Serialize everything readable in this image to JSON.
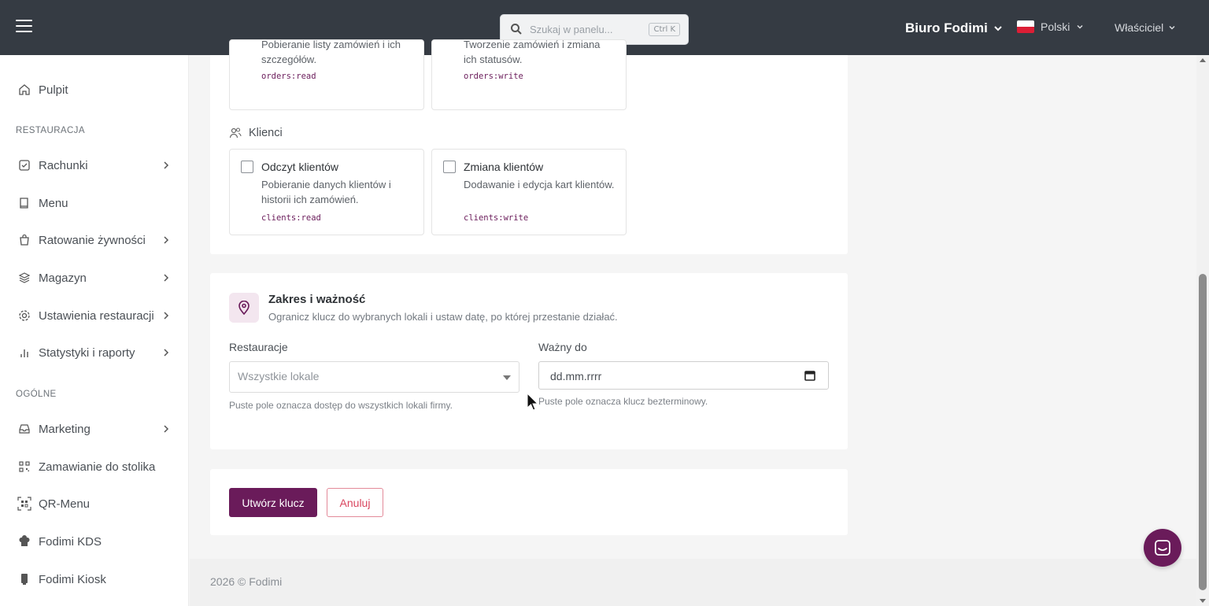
{
  "topbar": {
    "search_placeholder": "Szukaj w panelu...",
    "search_shortcut": "Ctrl K",
    "company": "Biuro Fodimi",
    "language": "Polski",
    "role": "Właściciel"
  },
  "sidebar": {
    "dashboard": "Pulpit",
    "section_restaurant": "RESTAURACJA",
    "restaurant_items": [
      {
        "label": "Rachunki",
        "icon": "checklist-icon",
        "submenu": true
      },
      {
        "label": "Menu",
        "icon": "book-icon",
        "submenu": false
      },
      {
        "label": "Ratowanie żywności",
        "icon": "shopping-bag-icon",
        "submenu": true
      },
      {
        "label": "Magazyn",
        "icon": "layers-icon",
        "submenu": true
      },
      {
        "label": "Ustawienia restauracji",
        "icon": "gear-icon",
        "submenu": true
      },
      {
        "label": "Statystyki i raporty",
        "icon": "bar-chart-icon",
        "submenu": true
      }
    ],
    "section_general": "OGÓLNE",
    "general_items": [
      {
        "label": "Marketing",
        "icon": "inbox-icon",
        "submenu": true
      },
      {
        "label": "Zamawianie do stolika",
        "icon": "qr-grid-icon",
        "submenu": false
      },
      {
        "label": "QR-Menu",
        "icon": "qr-scan-icon",
        "submenu": false
      },
      {
        "label": "Fodimi KDS",
        "icon": "chef-hat-icon",
        "submenu": false
      },
      {
        "label": "Fodimi Kiosk",
        "icon": "kiosk-icon",
        "submenu": false
      }
    ]
  },
  "permissions": {
    "orders_read": {
      "desc": "Pobieranie listy zamówień i ich szczegółów.",
      "code": "orders:read"
    },
    "orders_write": {
      "desc": "Tworzenie zamówień i zmiana ich statusów.",
      "code": "orders:write"
    },
    "clients_group": "Klienci",
    "clients_read": {
      "title": "Odczyt klientów",
      "desc": "Pobieranie danych klientów i historii ich zamówień.",
      "code": "clients:read"
    },
    "clients_write": {
      "title": "Zmiana klientów",
      "desc": "Dodawanie i edycja kart klientów.",
      "code": "clients:write"
    }
  },
  "scope": {
    "title": "Zakres i ważność",
    "subtitle": "Ogranicz klucz do wybranych lokali i ustaw datę, po której przestanie działać.",
    "restaurants_label": "Restauracje",
    "restaurants_value": "Wszystkie lokale",
    "restaurants_hint": "Puste pole oznacza dostęp do wszystkich lokali firmy.",
    "valid_label": "Ważny do",
    "valid_placeholder": "dd.mm.rrrr",
    "valid_hint": "Puste pole oznacza klucz bezterminowy."
  },
  "actions": {
    "create": "Utwórz klucz",
    "cancel": "Anuluj"
  },
  "footer": "2026 © Fodimi",
  "colors": {
    "brand": "#6a1b5a",
    "topbar": "#353b43",
    "cancel": "#d9465f"
  }
}
